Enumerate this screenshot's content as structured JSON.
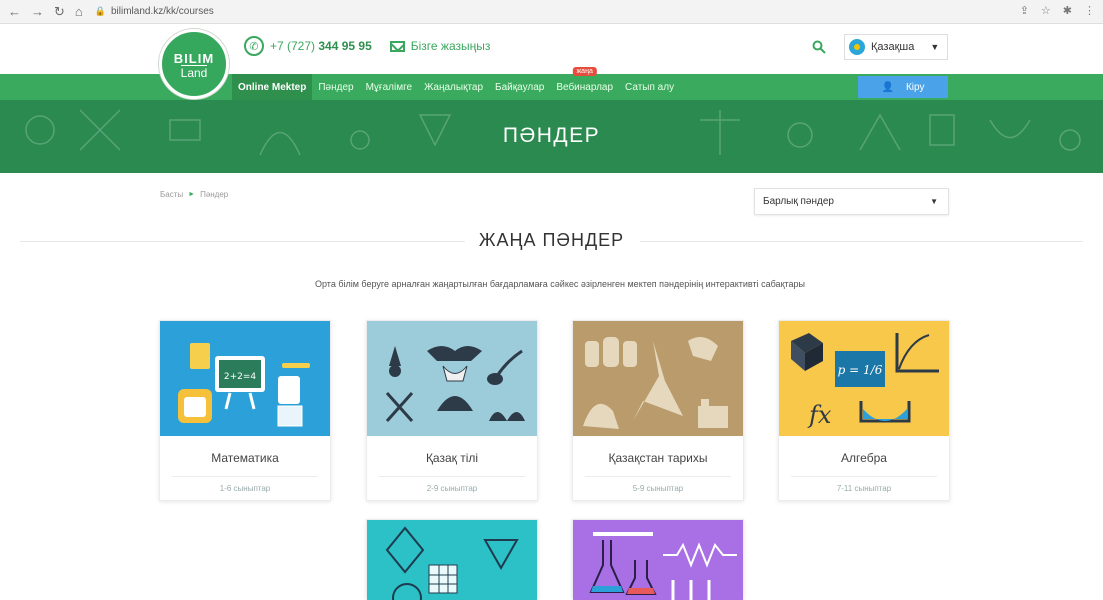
{
  "browser": {
    "url": "bilimland.kz/kk/courses"
  },
  "header": {
    "logo_line1": "BILIM",
    "logo_line2": "Land",
    "phone_prefix": "+7 (727)",
    "phone_number": "344 95 95",
    "write_us": "Бізге жазыңыз",
    "language": "Қазақша"
  },
  "nav": {
    "items": [
      {
        "label": "Online Mektep"
      },
      {
        "label": "Пәндер"
      },
      {
        "label": "Мұғалімге"
      },
      {
        "label": "Жаңалықтар"
      },
      {
        "label": "Байқаулар"
      },
      {
        "label": "Вебинарлар"
      },
      {
        "label": "Сатып алу"
      }
    ],
    "new_badge": "жаңа",
    "login": "Кіру"
  },
  "hero": {
    "title": "ПӘНДЕР"
  },
  "breadcrumb": {
    "home": "Басты",
    "current": "Пәндер"
  },
  "filter": {
    "selected": "Барлық пәндер"
  },
  "section": {
    "title": "ЖАҢА ПӘНДЕР",
    "description": "Орта білім беруге арналған жаңартылған бағдарламаға сәйкес әзірленген мектеп пәндерінің интерактивті сабақтары"
  },
  "cards": [
    {
      "name": "Математика",
      "grades": "1-6 сыныптар",
      "color": "#2ca1d9"
    },
    {
      "name": "Қазақ тілі",
      "grades": "2-9 сыныптар",
      "color": "#9ccbd9"
    },
    {
      "name": "Қазақстан тарихы",
      "grades": "5-9 сыныптар",
      "color": "#b99b6c"
    },
    {
      "name": "Алгебра",
      "grades": "7-11 сыныптар",
      "color": "#f7c84a"
    },
    {
      "name": "",
      "grades": "",
      "color": "#2cc1c6"
    },
    {
      "name": "",
      "grades": "",
      "color": "#a970e6"
    }
  ],
  "colors": {
    "brand_green": "#3aab5e",
    "hero_green": "#2a8a4f",
    "login_blue": "#4aa3e8"
  }
}
